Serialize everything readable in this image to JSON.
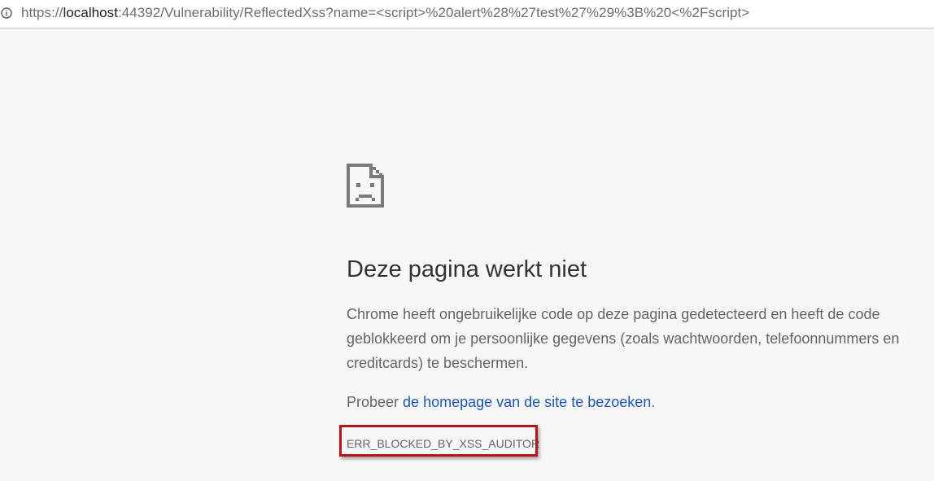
{
  "address_bar": {
    "url_scheme": "https://",
    "url_host": "localhost",
    "url_rest": ":44392/Vulnerability/ReflectedXss?name=<script>%20alert%28%27test%27%29%3B%20<%2Fscript>",
    "info_icon": "info-icon"
  },
  "error_page": {
    "icon": "sad-page-icon",
    "title": "Deze pagina werkt niet",
    "description": "Chrome heeft ongebruikelijke code op deze pagina gedetecteerd en heeft de code geblokkeerd om je persoonlijke gegevens (zoals wachtwoorden, telefoonnummers en creditcards) te beschermen.",
    "suggestion_prefix": "Probeer ",
    "suggestion_link": "de homepage van de site te bezoeken",
    "suggestion_suffix": ".",
    "error_code": "ERR_BLOCKED_BY_XSS_AUDITOR",
    "highlight_color": "#b3161c",
    "link_color": "#1f56b3"
  }
}
